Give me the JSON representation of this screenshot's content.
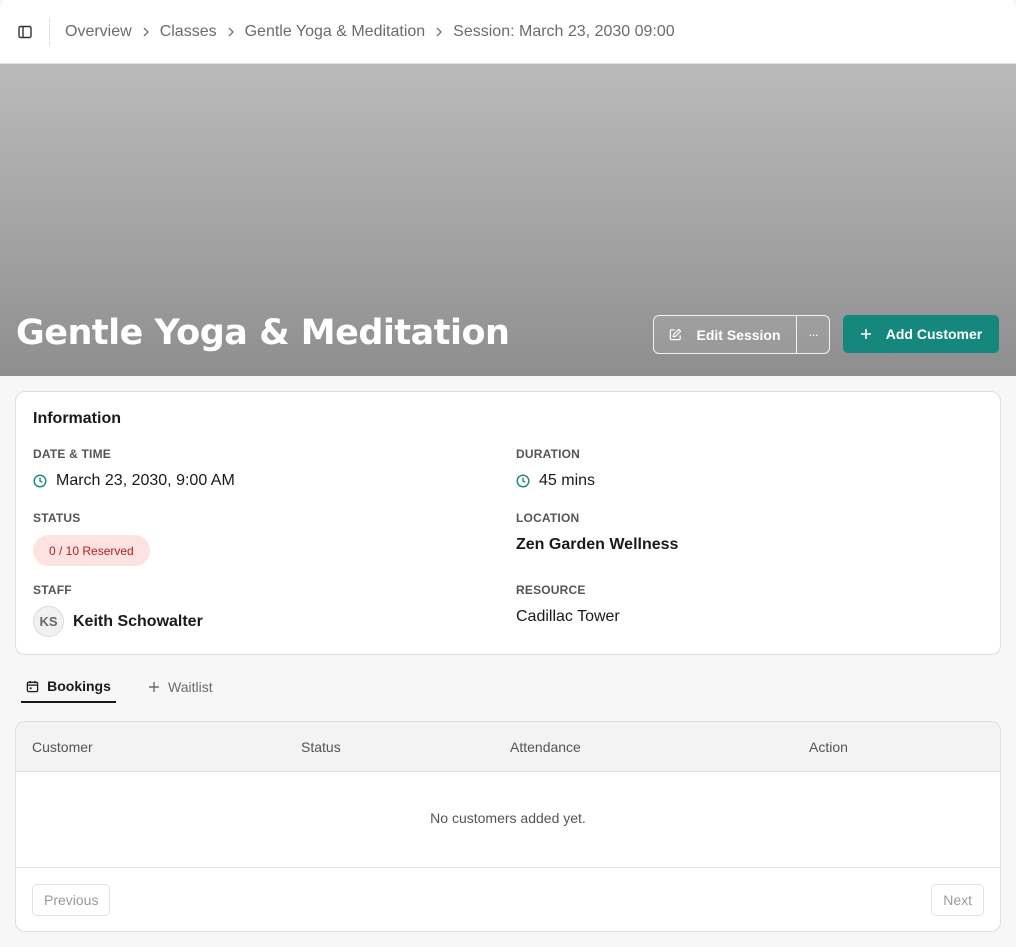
{
  "breadcrumb": {
    "items": [
      "Overview",
      "Classes",
      "Gentle Yoga & Meditation",
      "Session: March 23, 2030 09:00"
    ]
  },
  "hero": {
    "title": "Gentle Yoga & Meditation",
    "edit_label": "Edit Session",
    "more_label": "···",
    "add_label": "Add Customer"
  },
  "info": {
    "title": "Information",
    "date_time_label": "DATE & TIME",
    "date_time_value": "March 23, 2030, 9:00 AM",
    "duration_label": "DURATION",
    "duration_value": "45 mins",
    "status_label": "STATUS",
    "status_value": "0 / 10 Reserved",
    "location_label": "LOCATION",
    "location_value": "Zen Garden Wellness",
    "staff_label": "STAFF",
    "staff_initials": "KS",
    "staff_name": "Keith Schowalter",
    "resource_label": "RESOURCE",
    "resource_value": "Cadillac Tower"
  },
  "tabs": {
    "bookings": "Bookings",
    "waitlist": "Waitlist"
  },
  "table": {
    "columns": [
      "Customer",
      "Status",
      "Attendance",
      "Action"
    ],
    "empty_message": "No customers added yet.",
    "previous_label": "Previous",
    "next_label": "Next"
  },
  "colors": {
    "accent": "#16877c",
    "status_badge_bg": "#fde2e2",
    "status_badge_text": "#b32020"
  }
}
